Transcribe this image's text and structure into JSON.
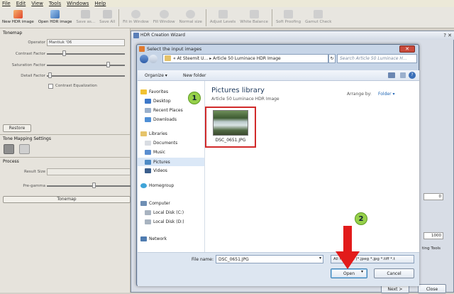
{
  "menu": {
    "file": "File",
    "edit": "Edit",
    "view": "View",
    "tools": "Tools",
    "windows": "Windows",
    "help": "Help"
  },
  "toolbar": {
    "new_hdr": "New HDR image",
    "open_hdr": "Open HDR image",
    "save_as": "Save as...",
    "save_all": "Save All",
    "fit_window": "Fit in Window",
    "fill_window": "Fill Window",
    "normal_size": "Normal size",
    "adjust_levels": "Adjust Levels",
    "white_balance": "White Balance",
    "soft_proofing": "Soft Proofing",
    "gamut_check": "Gamut Check"
  },
  "left": {
    "tonemap": "Tonemap",
    "operator_label": "Operator",
    "operator_value": "Mantiuk '06",
    "contrast_factor": "Contrast Factor",
    "saturation_factor": "Saturation Factor",
    "detail_factor": "Detail Factor",
    "contrast_eq": "Contrast Equalization",
    "restore": "Restore",
    "tm_settings": "Tone Mapping Settings",
    "process": "Process",
    "result_size": "Result Size",
    "pre_gamma": "Pre-gamma",
    "tonemap_btn": "Tonemap"
  },
  "wizard": {
    "title": "HDR Creation Wizard",
    "right_frag_1": "0",
    "right_frag_2": "1000",
    "right_frag_3": "ting Tools",
    "next": "Next >",
    "close": "Close"
  },
  "dialog": {
    "title": "Select the input images",
    "breadcrumb_1": "« At Steemit U...",
    "breadcrumb_2": "Article 50 Luminace HDR Image",
    "search_placeholder": "Search Article 50 Luminace H...",
    "organize": "Organize",
    "new_folder": "New folder",
    "library_title": "Pictures library",
    "library_sub": "Article 50 Luminace HDR Image",
    "arrange_label": "Arrange by:",
    "arrange_value": "Folder",
    "file_thumb_label": "DSC_0651.JPG",
    "filename_label": "File name:",
    "filename_value": "DSC_0651.JPG",
    "filter_value": "All formats (*.jpeg *.jpg *.tiff *.t",
    "open": "Open",
    "cancel": "Cancel",
    "annot_1": "1",
    "annot_2": "2"
  },
  "nav": {
    "favorites": "Favorites",
    "desktop": "Desktop",
    "recent": "Recent Places",
    "downloads": "Downloads",
    "libraries": "Libraries",
    "documents": "Documents",
    "music": "Music",
    "pictures": "Pictures",
    "videos": "Videos",
    "homegroup": "Homegroup",
    "computer": "Computer",
    "local_c": "Local Disk (C:)",
    "local_d": "Local Disk (D:)",
    "network": "Network"
  }
}
